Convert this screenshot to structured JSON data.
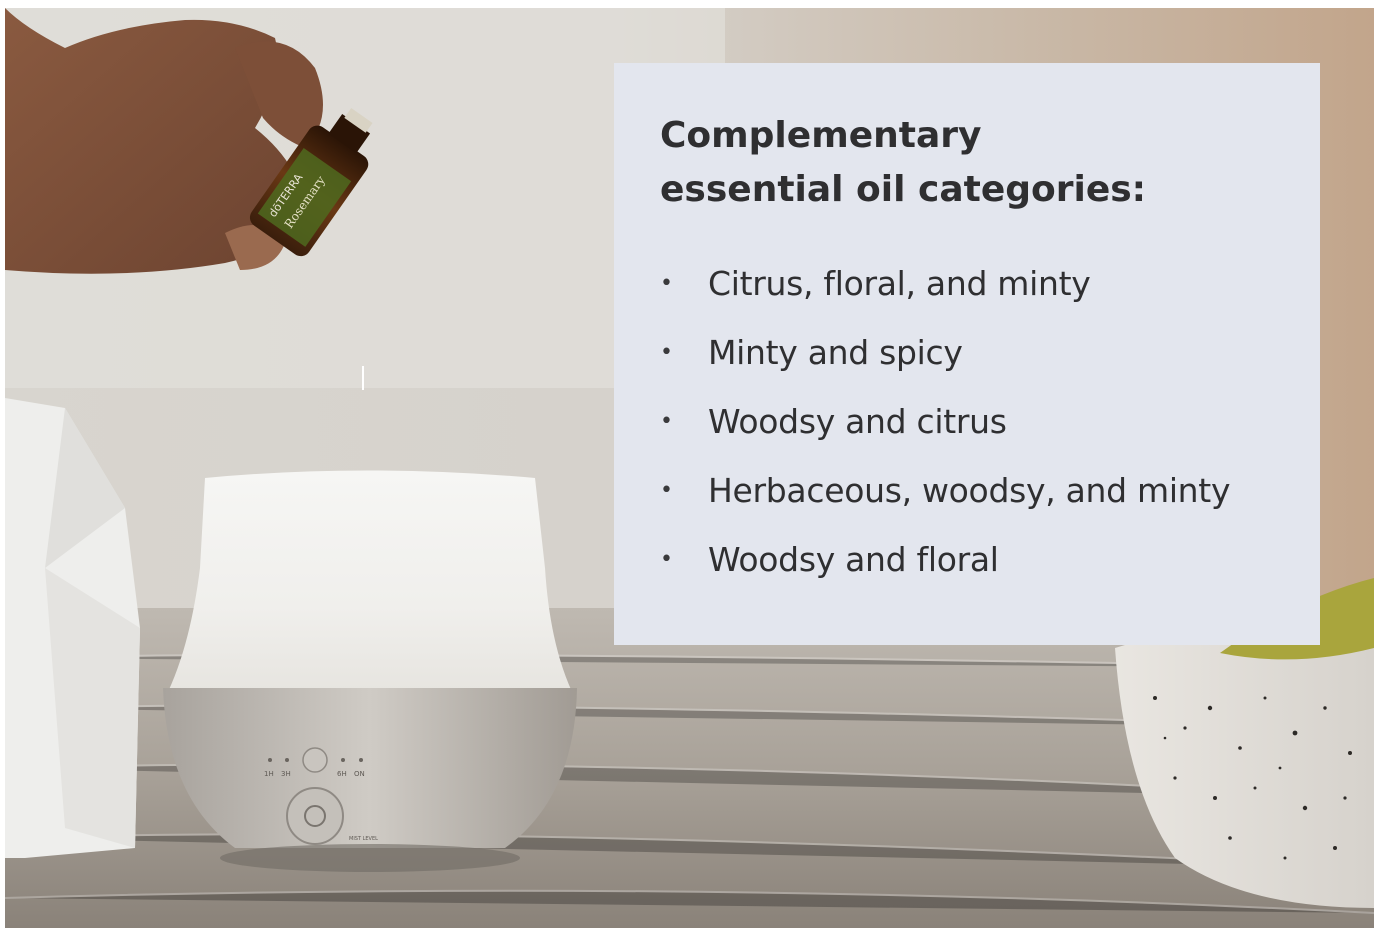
{
  "card": {
    "title_line1": "Complementary",
    "title_line2": "essential oil categories:",
    "items": [
      "Citrus, floral, and minty",
      "Minty and spicy",
      "Woodsy and citrus",
      "Herbaceous, woodsy, and minty",
      "Woodsy and floral"
    ]
  },
  "photo": {
    "bottle_brand": "dōTERRA",
    "bottle_label": "Rosemary",
    "diffuser_labels": {
      "timer_1h": "1H",
      "timer_3h": "3H",
      "timer_6h": "6H",
      "timer_on": "ON",
      "mist_level": "MIST LEVEL"
    }
  },
  "colors": {
    "card_background": "#e3e6ee",
    "text": "#2f2f31"
  }
}
